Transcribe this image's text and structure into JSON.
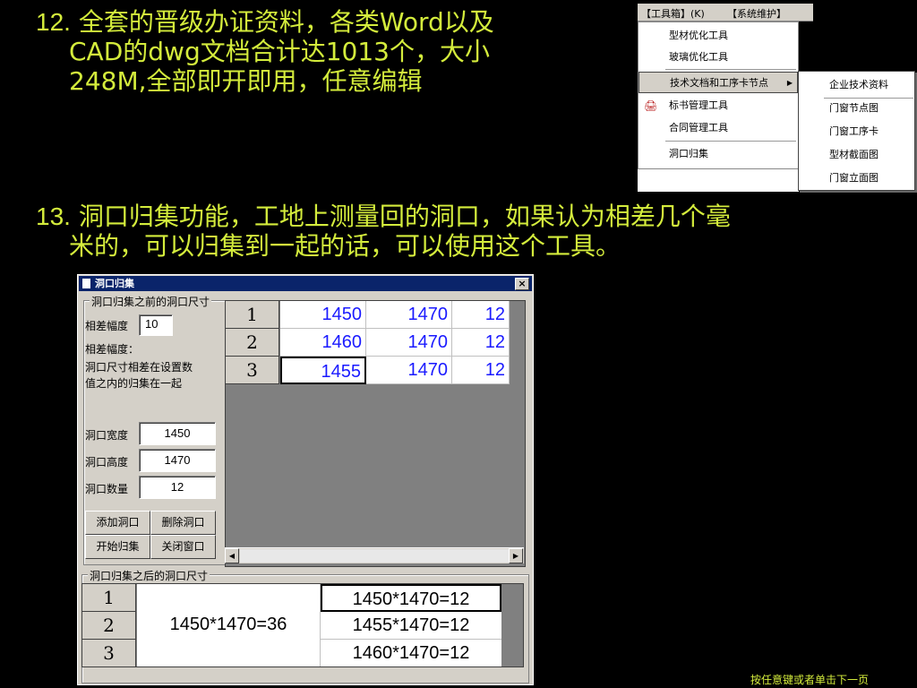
{
  "slide": {
    "p12": {
      "number": "12.",
      "line1": " 全套的晋级办证资料，各类Word以及",
      "line2": "CAD的dwg文档合计达1013个，大小",
      "line3": "248M,全部即开即用，任意编辑"
    },
    "p13": {
      "number": "13.",
      "line1": " 洞口归集功能，工地上测量回的洞口，如果认为相差几个毫",
      "line2": "米的，可以归集到一起的话，可以使用这个工具。"
    },
    "footer": "按任意键或者单击下一页"
  },
  "menu": {
    "bar": [
      "【工具箱】(K)",
      "【系统维护】"
    ],
    "items": [
      "型材优化工具",
      "玻璃优化工具",
      "技术文档和工序卡节点",
      "标书管理工具",
      "合同管理工具",
      "洞口归集"
    ],
    "submenu": [
      "企业技术资料",
      "门窗节点图",
      "门窗工序卡",
      "型材截面图",
      "门窗立面图"
    ]
  },
  "dialog": {
    "title": "洞口归集",
    "close": "×",
    "group_before": "洞口归集之前的洞口尺寸",
    "group_after": "洞口归集之后的洞口尺寸",
    "diff_label": "相差幅度",
    "diff_value": "10",
    "diff_note_title": "相差幅度：",
    "diff_note_1": "洞口尺寸相差在设置数",
    "diff_note_2": "值之内的归集在一起",
    "width_label": "洞口宽度",
    "width_value": "1450",
    "height_label": "洞口高度",
    "height_value": "1470",
    "count_label": "洞口数量",
    "count_value": "12",
    "btn_add": "添加洞口",
    "btn_delete": "删除洞口",
    "btn_start": "开始归集",
    "btn_close": "关闭窗口",
    "grid_before": [
      {
        "row": "1",
        "w": "1450",
        "h": "1470",
        "n": "12"
      },
      {
        "row": "2",
        "w": "1460",
        "h": "1470",
        "n": "12"
      },
      {
        "row": "3",
        "w": "1455",
        "h": "1470",
        "n": "12"
      }
    ],
    "grid_after": {
      "rows": [
        "1",
        "2",
        "3"
      ],
      "merged": "1450*1470=36",
      "details": [
        "1450*1470=12",
        "1455*1470=12",
        "1460*1470=12"
      ]
    }
  }
}
